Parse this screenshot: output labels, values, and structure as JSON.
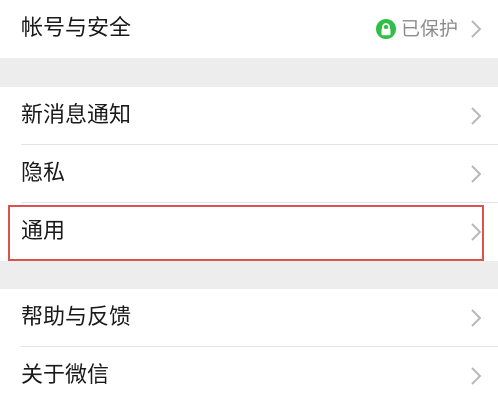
{
  "groups": [
    {
      "items": [
        {
          "label": "帐号与安全",
          "status": "已保护"
        }
      ]
    },
    {
      "items": [
        {
          "label": "新消息通知"
        },
        {
          "label": "隐私"
        },
        {
          "label": "通用"
        }
      ]
    },
    {
      "items": [
        {
          "label": "帮助与反馈"
        },
        {
          "label": "关于微信"
        }
      ]
    }
  ],
  "colors": {
    "background": "#ededed",
    "status_green": "#2fbf45",
    "highlight": "#d9534f"
  },
  "icons": {
    "status": "lock-icon",
    "row_arrow": "chevron-right-icon"
  }
}
